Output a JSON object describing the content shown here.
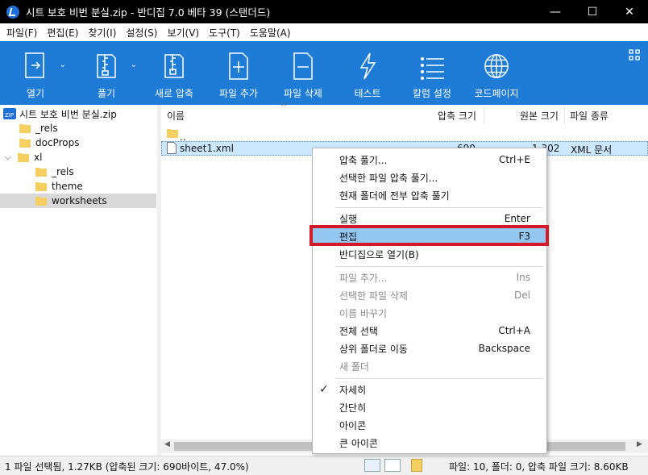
{
  "window": {
    "title": "시트 보호 비번 분실.zip - 반디집 7.0 베타 39 (스탠더드)",
    "minimize": "—",
    "maximize": "☐",
    "close": "✕"
  },
  "menubar": [
    "파일(F)",
    "편집(E)",
    "찾기(I)",
    "설정(S)",
    "보기(V)",
    "도구(T)",
    "도움말(A)"
  ],
  "toolbar": {
    "buttons": [
      {
        "label": "열기",
        "icon": "open-archive-icon"
      },
      {
        "label": "풀기",
        "icon": "extract-icon"
      },
      {
        "label": "새로 압축",
        "icon": "new-archive-icon"
      },
      {
        "label": "파일 추가",
        "icon": "add-file-icon"
      },
      {
        "label": "파일 삭제",
        "icon": "delete-file-icon"
      },
      {
        "label": "테스트",
        "icon": "test-icon"
      },
      {
        "label": "칼럼 설정",
        "icon": "columns-icon"
      },
      {
        "label": "코드페이지",
        "icon": "globe-icon"
      }
    ],
    "accent": "#1e7bd6"
  },
  "tree": {
    "root": "시트 보호 비번 분실.zip",
    "items": [
      "_rels",
      "docProps",
      "xl",
      "_rels",
      "theme",
      "worksheets"
    ]
  },
  "list": {
    "columns": [
      "이름",
      "압축 크기",
      "원본 크기",
      "파일 종류"
    ],
    "rows": [
      {
        "name": "..",
        "packed": "",
        "size": "",
        "type": ""
      },
      {
        "name": "sheet1.xml",
        "packed": "690",
        "size": "1,302",
        "type": "XML 문서"
      }
    ]
  },
  "context_menu": {
    "items": [
      {
        "label": "압축 풀기...",
        "key": "Ctrl+E"
      },
      {
        "label": "선택한 파일 압축 풀기...",
        "key": ""
      },
      {
        "label": "현재 폴더에 전부 압축 풀기",
        "key": ""
      },
      {
        "label": "실행",
        "key": "Enter"
      },
      {
        "label": "편집",
        "key": "F3"
      },
      {
        "label": "반디집으로 열기(B)",
        "key": ""
      },
      {
        "label": "파일 추가...",
        "key": "Ins"
      },
      {
        "label": "선택한 파일 삭제",
        "key": "Del"
      },
      {
        "label": "이름 바꾸기",
        "key": ""
      },
      {
        "label": "전체 선택",
        "key": "Ctrl+A"
      },
      {
        "label": "상위 폴더로 이동",
        "key": "Backspace"
      },
      {
        "label": "새 폴더",
        "key": ""
      },
      {
        "label": "자세히",
        "key": ""
      },
      {
        "label": "간단히",
        "key": ""
      },
      {
        "label": "아이콘",
        "key": ""
      },
      {
        "label": "큰 아이콘",
        "key": ""
      }
    ],
    "highlight_color": "#93c6f1",
    "outline_color": "#d31a2b"
  },
  "status": {
    "left": "1 파일 선택됨, 1.27KB (압축된 크기: 690바이트, 47.0%)",
    "right": "파일: 10, 폴더: 0, 압축 파일 크기: 8.60KB"
  }
}
